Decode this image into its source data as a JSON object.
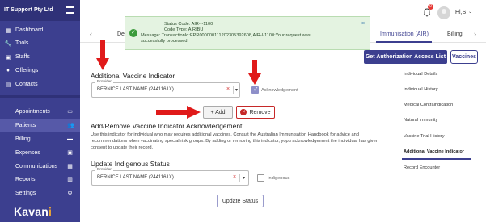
{
  "sidebar": {
    "org_name": "IT Support Pty Ltd",
    "items": [
      {
        "label": "Dashboard",
        "icon": "dashboard-icon",
        "glyph": "▦"
      },
      {
        "label": "Tools",
        "icon": "wrench-icon",
        "glyph": "🔧"
      },
      {
        "label": "Staffs",
        "icon": "staff-icon",
        "glyph": "▣"
      },
      {
        "label": "Offerings",
        "icon": "gift-icon",
        "glyph": "♦"
      },
      {
        "label": "Contacts",
        "icon": "contact-card-icon",
        "glyph": "▤"
      },
      {
        "label": "Appointments",
        "icon": "calendar-icon",
        "glyph": "▭"
      },
      {
        "label": "Patients",
        "icon": "patients-icon",
        "glyph": "👥"
      },
      {
        "label": "Billing",
        "icon": "billing-icon",
        "glyph": "▬"
      },
      {
        "label": "Expenses",
        "icon": "expenses-icon",
        "glyph": "▣"
      },
      {
        "label": "Communications",
        "icon": "communications-icon",
        "glyph": "▦"
      },
      {
        "label": "Reports",
        "icon": "reports-icon",
        "glyph": "▥"
      },
      {
        "label": "Settings",
        "icon": "gear-icon",
        "glyph": "⚙"
      }
    ],
    "brand": {
      "main": "Kavan",
      "accent": "i"
    }
  },
  "header": {
    "notification_count": "0",
    "username": "Hi,S",
    "caret": "⌄"
  },
  "tabs": {
    "prev": "‹",
    "next": "›",
    "partial_left": "Det",
    "items": [
      {
        "label": "Immunisation (AIR)",
        "active": true
      },
      {
        "label": "Billing",
        "active": false
      }
    ]
  },
  "toast": {
    "line1": "Status Code: AIR-I-1100",
    "line2": "Code Type: AIRIBU",
    "line3": "Message: TransactionId:EPR000000111202305392608,AIR-I-1100:Your request was",
    "line4": "successfully processed.",
    "close": "×",
    "check": "✓"
  },
  "actions": {
    "auth_button": "Get Authorization Access List",
    "vaccines_button": "Vaccines"
  },
  "right_menu": {
    "items": [
      {
        "label": "Individual Details",
        "active": false
      },
      {
        "label": "Individual History",
        "active": false
      },
      {
        "label": "Medical Contraindication",
        "active": false
      },
      {
        "label": "Natural Immunity",
        "active": false
      },
      {
        "label": "Vaccine Trial History",
        "active": false
      },
      {
        "label": "Additional Vaccine Indicator",
        "active": true
      },
      {
        "label": "Record Encounter",
        "active": false
      }
    ]
  },
  "avi": {
    "heading": "Additional Vaccine Indicator",
    "provider_label": "Provider",
    "provider_value": "BERNICE LAST NAME (2441161X)",
    "clear": "×",
    "caret": "▾",
    "ack_label": "Acknowledgement",
    "ack_checked": true,
    "add_label": "+ Add",
    "remove_label": "Remove",
    "remove_icon": "×"
  },
  "ack_section": {
    "heading": "Add/Remove Vaccine Indicator Acknowledgement",
    "paragraph": "Use this indicator for individual who may requires additional vaccines. Consult the Australian Immunisation Handbook for advice and recommendations when vaccinating special risk groups. By adding or removing this indicator, yopu acknowledgement the individual has given consent to update their record."
  },
  "indigenous": {
    "heading": "Update Indigenous Status",
    "provider_label": "Provider",
    "provider_value": "BERNICE LAST NAME (2441161X)",
    "clear": "×",
    "caret": "▾",
    "check_label": "Indigenous",
    "checked": false,
    "update_label": "Update Status"
  },
  "colors": {
    "sidebar": "#3c3f8f",
    "accent": "#3c3f8f",
    "toast_bg": "#e4f3e1",
    "annotation_red": "#e01a1a",
    "remove_red": "#c62828"
  }
}
